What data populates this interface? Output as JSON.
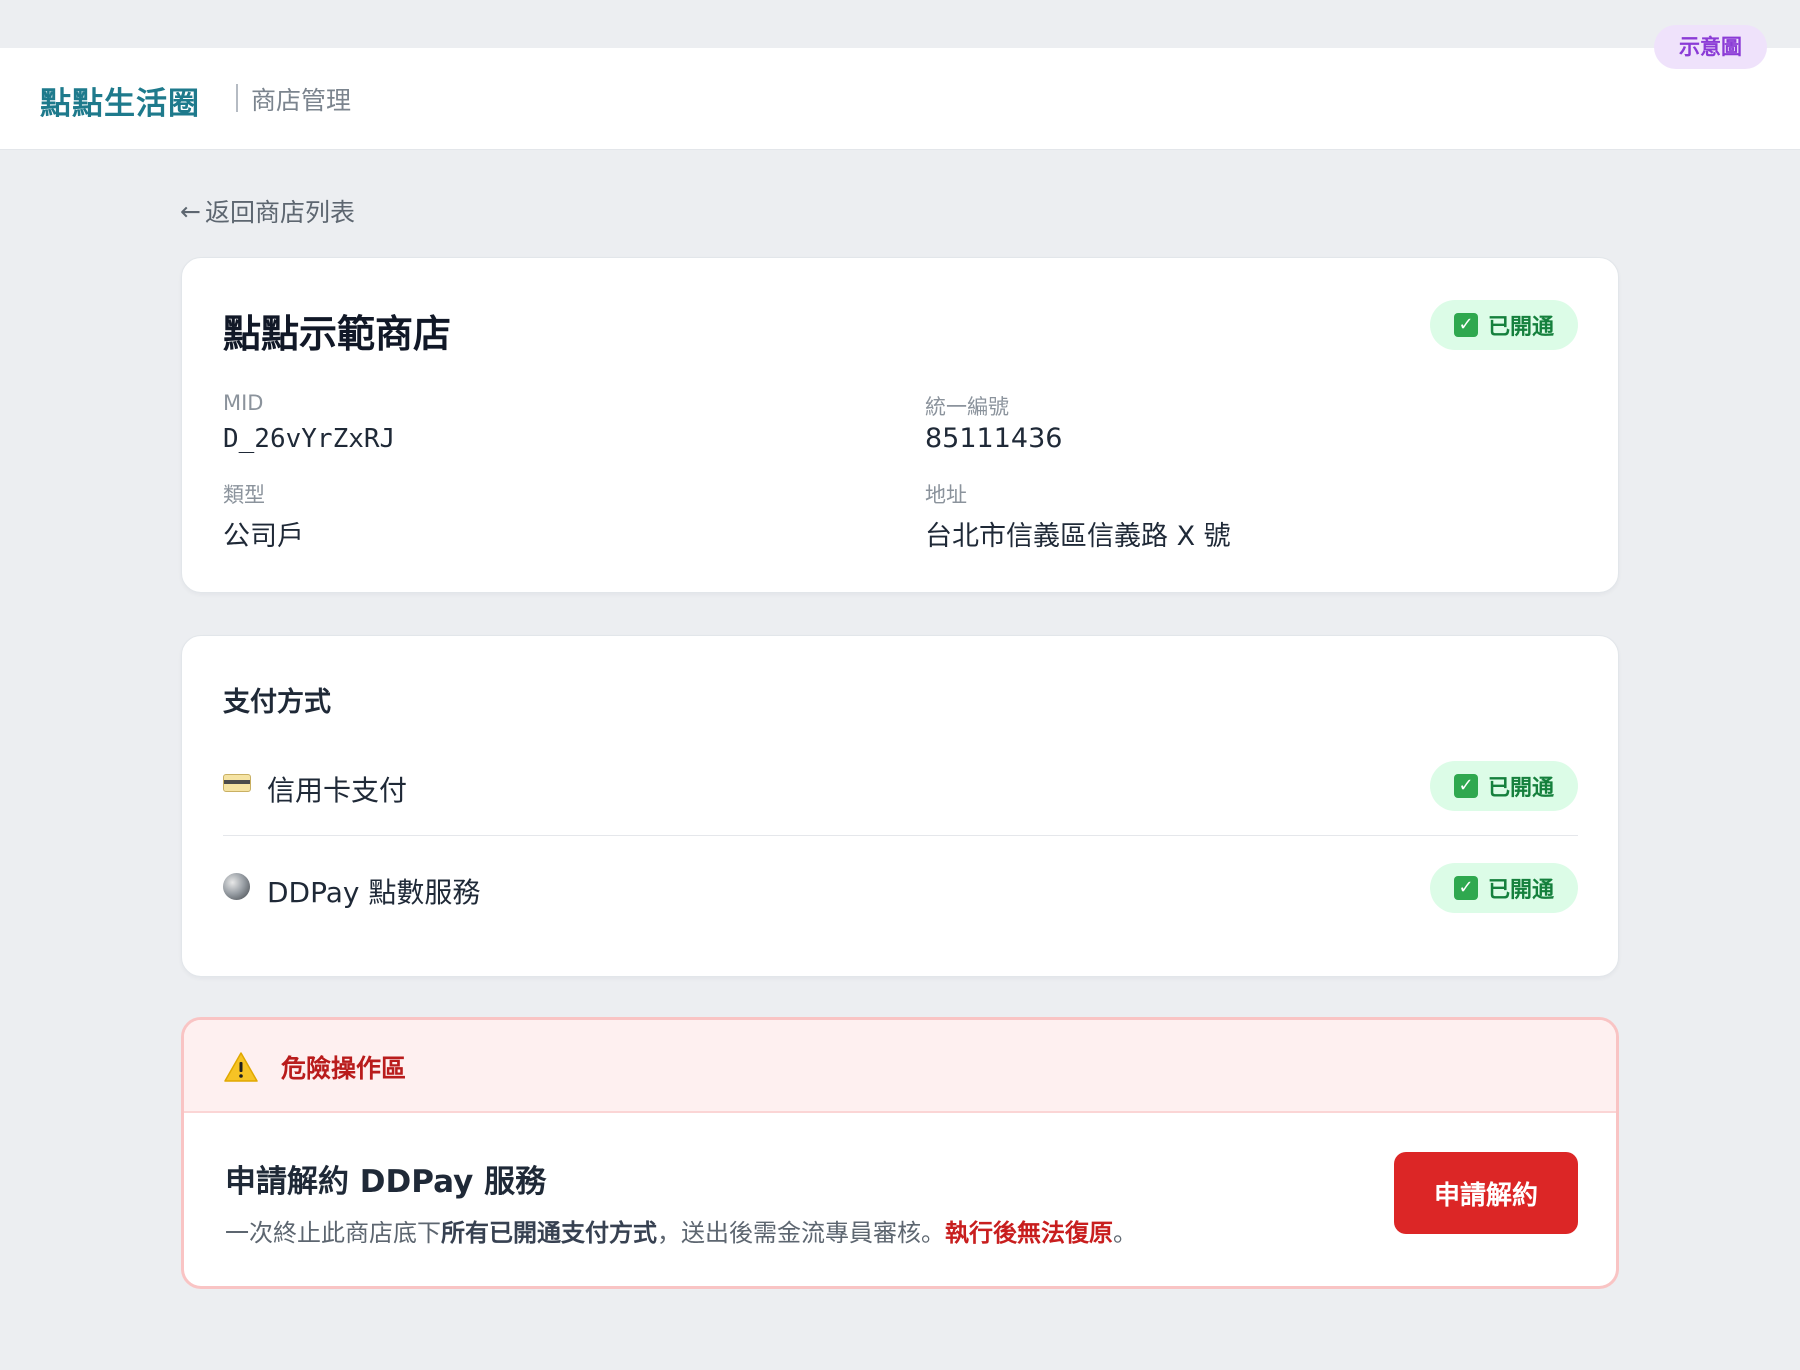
{
  "header": {
    "brand": "點點生活圈",
    "subtitle": "商店管理",
    "demo_badge": "示意圖"
  },
  "nav": {
    "back_arrow": "←",
    "back_label": "返回商店列表"
  },
  "store": {
    "name": "點點示範商店",
    "status": "已開通",
    "fields": {
      "mid_label": "MID",
      "mid_value": "D_26vYrZxRJ",
      "tax_id_label": "統一編號",
      "tax_id_value": "85111436",
      "type_label": "類型",
      "type_value": "公司戶",
      "address_label": "地址",
      "address_value": "台北市信義區信義路 X 號"
    }
  },
  "payment": {
    "title": "支付方式",
    "methods": [
      {
        "icon": "credit-card-icon",
        "label": "信用卡支付",
        "status": "已開通"
      },
      {
        "icon": "coin-icon",
        "label": "DDPay 點數服務",
        "status": "已開通"
      }
    ]
  },
  "danger_zone": {
    "title": "危險操作區",
    "action_title": "申請解約 DDPay 服務",
    "desc_part1": "一次終止此商店底下",
    "desc_bold": "所有已開通支付方式",
    "desc_part2": "，送出後需金流專員審核。",
    "desc_red": "執行後無法復原",
    "desc_end": "。",
    "button_label": "申請解約"
  },
  "colors": {
    "brand": "#1e7a8c",
    "success_bg": "#dcfce7",
    "success_text": "#15803d",
    "danger": "#dc2626",
    "demo_badge_bg": "#efe2fb",
    "demo_badge_text": "#8b3bd6"
  }
}
